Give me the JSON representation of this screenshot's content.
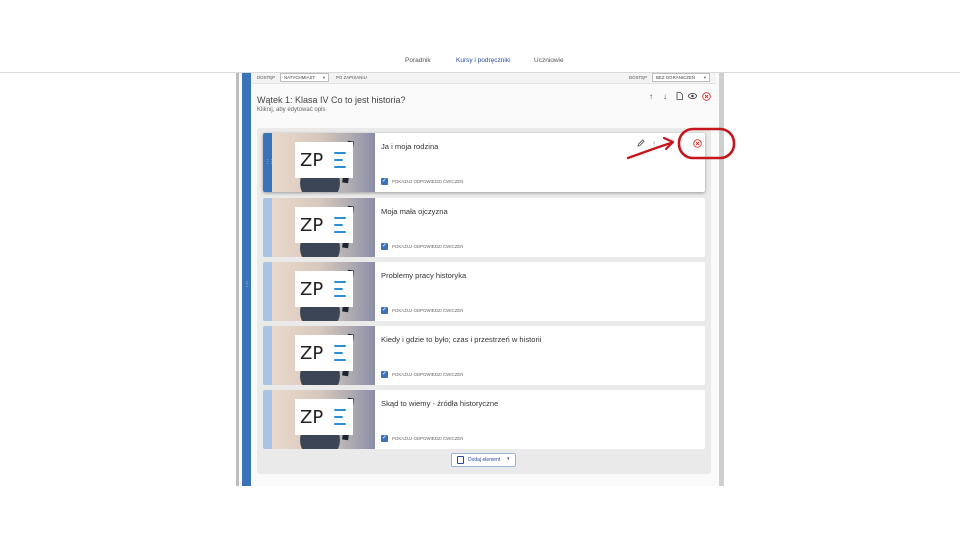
{
  "nav": {
    "tabs": [
      {
        "label": "Poradnik"
      },
      {
        "label": "Kursy i podręczniki"
      },
      {
        "label": "Uczniowie"
      }
    ]
  },
  "access": {
    "left_label": "DOSTĘP",
    "left_value": "NATYCHMIAST",
    "after_save": "PO ZAPISANIU",
    "right_label": "DOSTĘP",
    "right_value": "BEZ OGRANICZEŃ"
  },
  "thread": {
    "title": "Wątek 1: Klasa IV Co to jest historia?",
    "description": "Kliknij, aby edytować opis"
  },
  "cards": [
    {
      "title": "Ja i moja rodzina",
      "checkbox_label": "POKAZUJ ODPOWIEDZI ĆWICZEŃ"
    },
    {
      "title": "Moja mała ojczyzna",
      "checkbox_label": "POKAZUJ ODPOWIEDZI ĆWICZEŃ"
    },
    {
      "title": "Problemy pracy historyka",
      "checkbox_label": "POKAZUJ ODPOWIEDZI ĆWICZEŃ"
    },
    {
      "title": "Kiedy i gdzie to było; czas i przestrzeń w historii",
      "checkbox_label": "POKAZUJ ODPOWIEDZI ĆWICZEŃ"
    },
    {
      "title": "Skąd to wiemy - źródła historyczne",
      "checkbox_label": "POKAZUJ ODPOWIEDZI ĆWICZEŃ"
    }
  ],
  "thumbnail_logo": "ZP",
  "add_button": {
    "label": "Dodaj element"
  },
  "colors": {
    "accent": "#3a73b8",
    "active_tab": "#2c4aa0",
    "delete_red": "#d6322e",
    "annotation_red": "#c4161c"
  },
  "icons": [
    "arrow-up-icon",
    "arrow-down-icon",
    "copy-icon",
    "eye-icon",
    "delete-icon",
    "pencil-icon",
    "drag-handle-icon",
    "chevron-down-icon",
    "document-icon"
  ]
}
